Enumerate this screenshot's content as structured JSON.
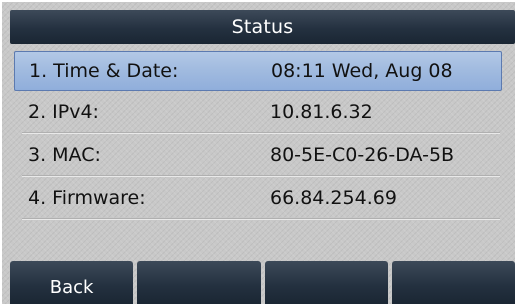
{
  "title": "Status",
  "items": [
    {
      "label": "1. Time & Date:",
      "value": "08:11 Wed, Aug 08"
    },
    {
      "label": "2. IPv4:",
      "value": "10.81.6.32"
    },
    {
      "label": "3. MAC:",
      "value": "80-5E-C0-26-DA-5B"
    },
    {
      "label": "4. Firmware:",
      "value": "66.84.254.69"
    }
  ],
  "softkeys": [
    "Back",
    "",
    "",
    ""
  ],
  "colors": {
    "title_bar": "#243140",
    "selected_row": "#a0badf",
    "screen_bg": "#c8c8c8"
  }
}
